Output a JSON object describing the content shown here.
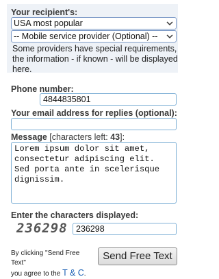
{
  "recipient": {
    "label": "Your recipient's:",
    "country_select": "USA most popular",
    "provider_select": "-- Mobile service provider (Optional) --",
    "help_text": "Some providers have special requirements, the information - if known - will be displayed here."
  },
  "phone": {
    "label": "Phone number:",
    "value": "4844835801"
  },
  "email": {
    "label": "Your email address for replies (optional):",
    "value": ""
  },
  "message": {
    "label_prefix": "Message",
    "label_chars_prefix": "[characters left:",
    "chars_left": "43",
    "label_suffix": "]:",
    "value": "Lorem ipsum dolor sit amet, consectetur adipiscing elit. Sed porta ante in scelerisque dignissim."
  },
  "captcha": {
    "label": "Enter the characters displayed:",
    "image_text": "236298",
    "value": "236298"
  },
  "footer": {
    "note_line1": "By clicking \"Send Free Text\"",
    "note_line2": "you agree to the",
    "terms_link": "T & C",
    "terms_period": ".",
    "send_button": "Send Free Text"
  }
}
